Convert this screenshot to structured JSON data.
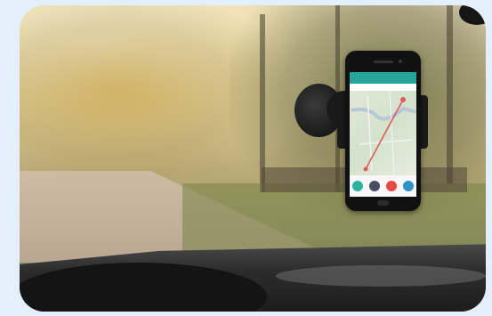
{
  "scene": {
    "description_colors": {
      "background": "#e3f0fb",
      "phone_header": "#26a69a",
      "route": "#e05a5a"
    },
    "phone": {
      "buttons": [
        {
          "name": "green-button",
          "color": "#2bb3a0"
        },
        {
          "name": "dark-button",
          "color": "#4b4b63"
        },
        {
          "name": "red-button",
          "color": "#e64a4a"
        },
        {
          "name": "blue-button",
          "color": "#2c92c7"
        }
      ]
    }
  }
}
